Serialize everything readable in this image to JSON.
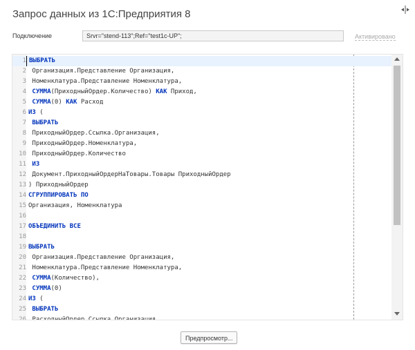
{
  "window": {
    "title": "Запрос данных из 1С:Предприятия 8"
  },
  "connection": {
    "label": "Подключение",
    "value": "Srvr=\"stend-113\";Ref=\"test1c-UP\";",
    "status_link": "Активировано"
  },
  "editor": {
    "lines": [
      {
        "num": "1",
        "segments": [
          {
            "text": "ВЫБРАТЬ",
            "kw": true
          }
        ]
      },
      {
        "num": "2",
        "segments": [
          {
            "text": " Организация.Представление Организация,",
            "kw": false
          }
        ]
      },
      {
        "num": "3",
        "segments": [
          {
            "text": " Номенклатура.Представление Номенклатура,",
            "kw": false
          }
        ]
      },
      {
        "num": "4",
        "segments": [
          {
            "text": " ",
            "kw": false
          },
          {
            "text": "СУММА",
            "kw": true
          },
          {
            "text": "(ПриходныйОрдер.Количество) ",
            "kw": false
          },
          {
            "text": "КАК",
            "kw": true
          },
          {
            "text": " Приход,",
            "kw": false
          }
        ]
      },
      {
        "num": "5",
        "segments": [
          {
            "text": " ",
            "kw": false
          },
          {
            "text": "СУММА",
            "kw": true
          },
          {
            "text": "(0) ",
            "kw": false
          },
          {
            "text": "КАК",
            "kw": true
          },
          {
            "text": " Расход",
            "kw": false
          }
        ]
      },
      {
        "num": "6",
        "segments": [
          {
            "text": "ИЗ",
            "kw": true
          },
          {
            "text": " (",
            "kw": false
          }
        ]
      },
      {
        "num": "7",
        "segments": [
          {
            "text": " ",
            "kw": false
          },
          {
            "text": "ВЫБРАТЬ",
            "kw": true
          }
        ]
      },
      {
        "num": "8",
        "segments": [
          {
            "text": " ПриходныйОрдер.Ссылка.Организация,",
            "kw": false
          }
        ]
      },
      {
        "num": "9",
        "segments": [
          {
            "text": " ПриходныйОрдер.Номенклатура,",
            "kw": false
          }
        ]
      },
      {
        "num": "10",
        "segments": [
          {
            "text": " ПриходныйОрдер.Количество",
            "kw": false
          }
        ]
      },
      {
        "num": "11",
        "segments": [
          {
            "text": " ",
            "kw": false
          },
          {
            "text": "ИЗ",
            "kw": true
          }
        ]
      },
      {
        "num": "12",
        "segments": [
          {
            "text": " Документ.ПриходныйОрдерНаТовары.Товары ПриходныйОрдер",
            "kw": false
          }
        ]
      },
      {
        "num": "13",
        "segments": [
          {
            "text": ") ПриходныйОрдер",
            "kw": false
          }
        ]
      },
      {
        "num": "14",
        "segments": [
          {
            "text": "СГРУППИРОВАТЬ ПО",
            "kw": true
          }
        ]
      },
      {
        "num": "15",
        "segments": [
          {
            "text": "Организация, Номенклатура",
            "kw": false
          }
        ]
      },
      {
        "num": "16",
        "segments": []
      },
      {
        "num": "17",
        "segments": [
          {
            "text": "ОБЪЕДИНИТЬ ВСЕ",
            "kw": true
          }
        ]
      },
      {
        "num": "18",
        "segments": []
      },
      {
        "num": "19",
        "segments": [
          {
            "text": "ВЫБРАТЬ",
            "kw": true
          }
        ]
      },
      {
        "num": "20",
        "segments": [
          {
            "text": " Организация.Представление Организация,",
            "kw": false
          }
        ]
      },
      {
        "num": "21",
        "segments": [
          {
            "text": " Номенклатура.Представление Номенклатура,",
            "kw": false
          }
        ]
      },
      {
        "num": "22",
        "segments": [
          {
            "text": " ",
            "kw": false
          },
          {
            "text": "СУММА",
            "kw": true
          },
          {
            "text": "(Количество),",
            "kw": false
          }
        ]
      },
      {
        "num": "23",
        "segments": [
          {
            "text": " ",
            "kw": false
          },
          {
            "text": "СУММА",
            "kw": true
          },
          {
            "text": "(0)",
            "kw": false
          }
        ]
      },
      {
        "num": "24",
        "segments": [
          {
            "text": "ИЗ",
            "kw": true
          },
          {
            "text": " (",
            "kw": false
          }
        ]
      },
      {
        "num": "25",
        "segments": [
          {
            "text": " ",
            "kw": false
          },
          {
            "text": "ВЫБРАТЬ",
            "kw": true
          }
        ]
      },
      {
        "num": "26",
        "segments": [
          {
            "text": " РасходныйОрдер.Ссылка.Организация,",
            "kw": false
          }
        ]
      }
    ]
  },
  "buttons": {
    "preview": "Предпросмотр..."
  }
}
